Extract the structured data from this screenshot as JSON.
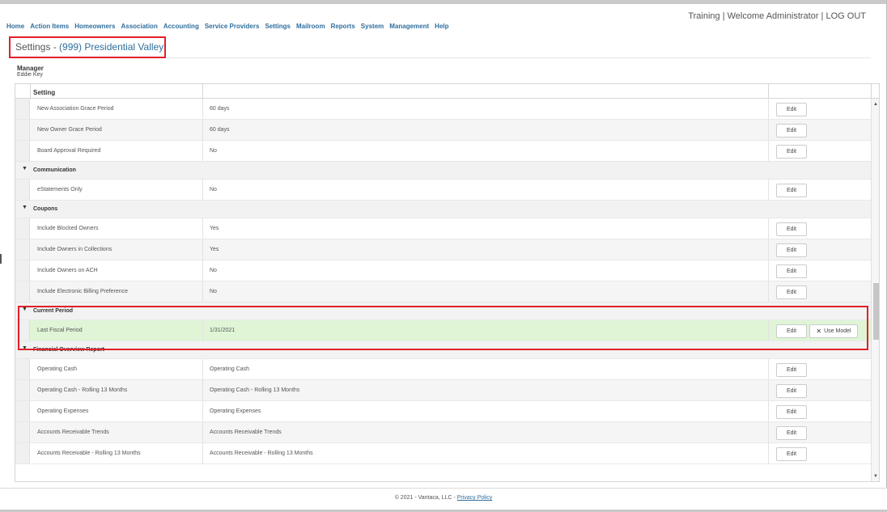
{
  "nav": {
    "items": [
      "Home",
      "Action Items",
      "Homeowners",
      "Association",
      "Accounting",
      "Service Providers",
      "Settings",
      "Mailroom",
      "Reports",
      "System",
      "Management",
      "Help"
    ]
  },
  "account": {
    "text": "Training | Welcome Administrator | ",
    "logout": "LOG OUT"
  },
  "page": {
    "title_prefix": "Settings - ",
    "association": "(999) Presidential Valley",
    "manager_label": "Manager",
    "manager_name": "Eddie Key"
  },
  "grid": {
    "header": "Setting",
    "edit_label": "Edit",
    "use_model_label": "Use Model",
    "rows": [
      {
        "type": "item",
        "setting": "New Association Grace Period",
        "value": "60 days"
      },
      {
        "type": "item",
        "setting": "New Owner Grace Period",
        "value": "60 days"
      },
      {
        "type": "item",
        "setting": "Board Approval Required",
        "value": "No"
      },
      {
        "type": "group",
        "label": "Communication"
      },
      {
        "type": "item",
        "setting": "eStatements Only",
        "value": "No"
      },
      {
        "type": "group",
        "label": "Coupons"
      },
      {
        "type": "item",
        "setting": "Include Blocked Owners",
        "value": "Yes"
      },
      {
        "type": "item",
        "setting": "Include Owners in Collections",
        "value": "Yes"
      },
      {
        "type": "item",
        "setting": "Include Owners on ACH",
        "value": "No"
      },
      {
        "type": "item",
        "setting": "Include Electronic Billing Preference",
        "value": "No"
      },
      {
        "type": "group",
        "label": "Current Period"
      },
      {
        "type": "item",
        "setting": "Last Fiscal Period",
        "value": "1/31/2021",
        "highlight": true,
        "use_model": true
      },
      {
        "type": "group",
        "label": "Financial Overview Report"
      },
      {
        "type": "item",
        "setting": "Operating Cash",
        "value": "Operating Cash"
      },
      {
        "type": "item",
        "setting": "Operating Cash - Rolling 13 Months",
        "value": "Operating Cash - Rolling 13 Months"
      },
      {
        "type": "item",
        "setting": "Operating Expenses",
        "value": "Operating Expenses"
      },
      {
        "type": "item",
        "setting": "Accounts Receivable Trends",
        "value": "Accounts Receivable Trends"
      },
      {
        "type": "item",
        "setting": "Accounts Receivable - Rolling 13 Months",
        "value": "Accounts Receivable - Rolling 13 Months"
      }
    ]
  },
  "footer": {
    "copyright": "© 2021 - Vantaca, LLC - ",
    "privacy": "Privacy Policy"
  },
  "colors": {
    "link": "#2f6f9e",
    "highlight_row": "#dff5d6",
    "annotation_box": "#e0202a"
  }
}
